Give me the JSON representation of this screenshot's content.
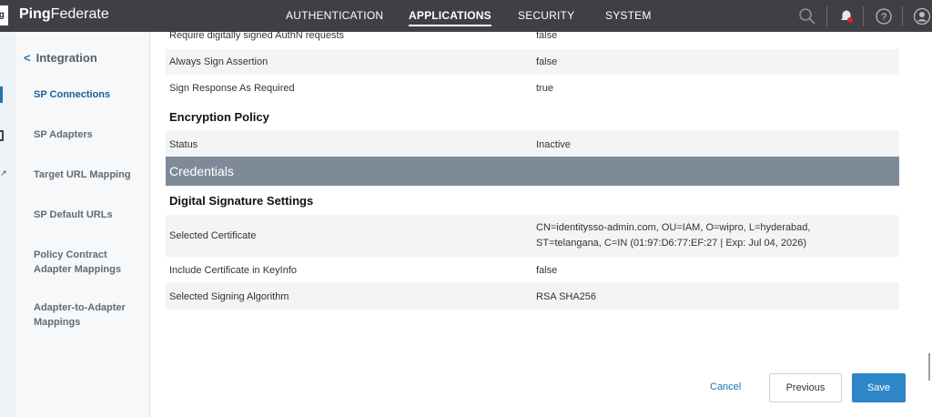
{
  "header": {
    "logo_fragment": "ig",
    "brand_bold": "Ping",
    "brand_rest": "Federate",
    "nav": [
      "AUTHENTICATION",
      "APPLICATIONS",
      "SECURITY",
      "SYSTEM"
    ],
    "active_nav": "APPLICATIONS",
    "icons": [
      "search-icon",
      "notification-bell-icon",
      "help-icon",
      "user-icon"
    ]
  },
  "sidebar": {
    "back_label": "Integration",
    "items": [
      {
        "label": "SP Connections",
        "active": true
      },
      {
        "label": "SP Adapters",
        "active": false
      },
      {
        "label": "Target URL Mapping",
        "active": false
      },
      {
        "label": "SP Default URLs",
        "active": false
      },
      {
        "label": "Policy Contract Adapter Mappings",
        "active": false
      },
      {
        "label": "Adapter-to-Adapter Mappings",
        "active": false
      }
    ]
  },
  "main": {
    "rows_top": [
      {
        "label": "Require digitally signed AuthN requests",
        "value": "false"
      },
      {
        "label": "Always Sign Assertion",
        "value": "false"
      },
      {
        "label": "Sign Response As Required",
        "value": "true"
      }
    ],
    "encryption_title": "Encryption Policy",
    "encryption_rows": [
      {
        "label": "Status",
        "value": "Inactive"
      }
    ],
    "credentials_title": "Credentials",
    "digital_signature_title": "Digital Signature Settings",
    "signature_rows": [
      {
        "label": "Selected Certificate",
        "value_line1": "CN=identitysso-admin.com, OU=IAM, O=wipro, L=hyderabad,",
        "value_line2": "ST=telangana, C=IN (01:97:D6:77:EF:27 | Exp: Jul 04, 2026)"
      },
      {
        "label": "Include Certificate in KeyInfo",
        "value": "false"
      },
      {
        "label": "Selected Signing Algorithm",
        "value": "RSA SHA256"
      }
    ]
  },
  "footer": {
    "cancel_label": "Cancel",
    "previous_label": "Previous",
    "save_label": "Save"
  },
  "colors": {
    "topbar": "#3f4043",
    "accent": "#1e74b3",
    "credentials_bar": "#7f8a99",
    "save_button": "#2e86c8"
  }
}
